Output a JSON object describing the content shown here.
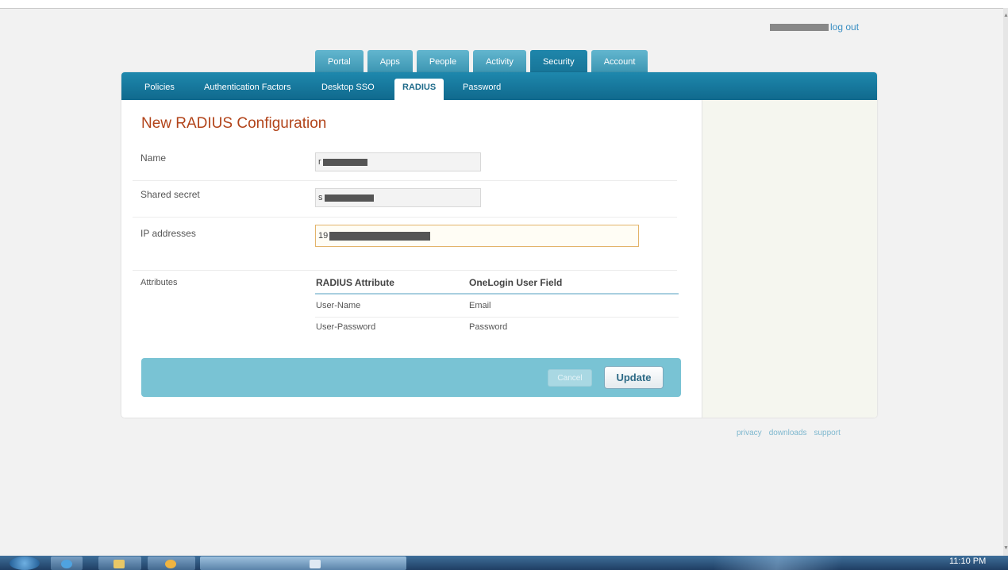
{
  "header": {
    "logout_label": "log out"
  },
  "main_tabs": [
    {
      "label": "Portal"
    },
    {
      "label": "Apps"
    },
    {
      "label": "People"
    },
    {
      "label": "Activity"
    },
    {
      "label": "Security",
      "active": true
    },
    {
      "label": "Account"
    }
  ],
  "sub_tabs": [
    {
      "label": "Policies"
    },
    {
      "label": "Authentication Factors"
    },
    {
      "label": "Desktop SSO"
    },
    {
      "label": "RADIUS",
      "active": true
    },
    {
      "label": "Password"
    }
  ],
  "page_title": "New RADIUS Configuration",
  "form": {
    "name": {
      "label": "Name",
      "value": "r"
    },
    "shared_secret": {
      "label": "Shared secret",
      "value": "s"
    },
    "ip_addresses": {
      "label": "IP addresses",
      "value": "19"
    }
  },
  "attributes": {
    "label": "Attributes",
    "col_radius": "RADIUS Attribute",
    "col_onelogin": "OneLogin User Field",
    "rows": [
      {
        "radius": "User-Name",
        "field": "Email"
      },
      {
        "radius": "User-Password",
        "field": "Password"
      }
    ]
  },
  "actions": {
    "cancel_label": "Cancel",
    "update_label": "Update"
  },
  "footer": {
    "privacy": "privacy",
    "downloads": "downloads",
    "support": "support"
  },
  "taskbar": {
    "clock": "11:10 PM"
  },
  "colors": {
    "title_accent": "#b2441a",
    "nav_blue": "#1b7ca3",
    "action_bar": "#79c3d4",
    "link": "#3a8fc3"
  }
}
